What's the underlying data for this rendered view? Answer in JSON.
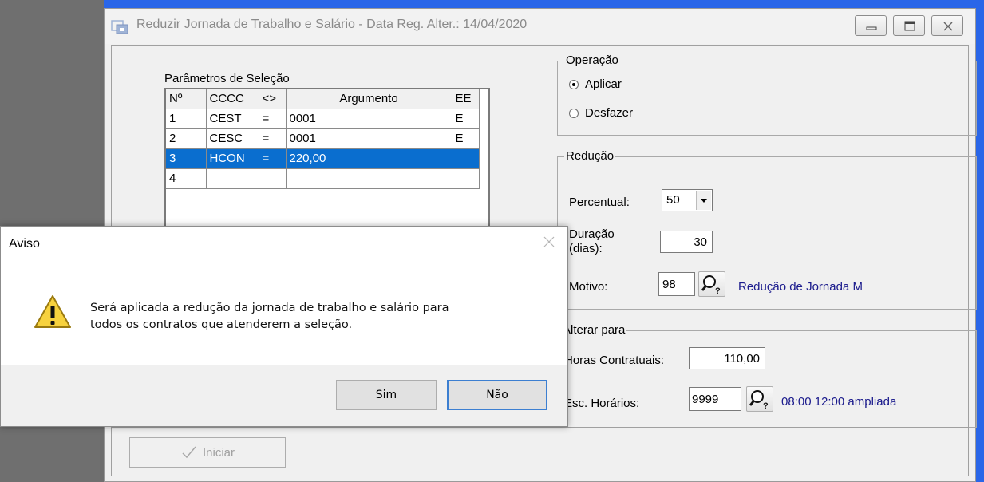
{
  "window": {
    "title": "Reduzir Jornada de Trabalho e Salário - Data Reg. Alter.: 14/04/2020"
  },
  "params": {
    "label": "Parâmetros de Seleção",
    "columns": [
      "Nº",
      "CCCC",
      "<>",
      "Argumento",
      "EE"
    ],
    "rows": [
      [
        "1",
        "CEST",
        "=",
        "0001",
        "E"
      ],
      [
        "2",
        "CESC",
        "=",
        "0001",
        "E"
      ],
      [
        "3",
        "HCON",
        "=",
        "220,00",
        ""
      ],
      [
        "4",
        "",
        "",
        "",
        ""
      ]
    ],
    "selected_row": 2
  },
  "operacao": {
    "title": "Operação",
    "aplicar": "Aplicar",
    "desfazer": "Desfazer",
    "selected": "Aplicar"
  },
  "reducao": {
    "title": "Redução",
    "percentual_label": "Percentual:",
    "percentual_value": "50",
    "duracao_label_1": "Duração",
    "duracao_label_2": "(dias):",
    "duracao_value": "30",
    "motivo_label": "Motivo:",
    "motivo_value": "98",
    "motivo_desc": "Redução de Jornada M"
  },
  "alterar": {
    "title": "Alterar para",
    "horas_label": "Horas Contratuais:",
    "horas_value": "110,00",
    "esc_label": "Esc. Horários:",
    "esc_value": "9999",
    "esc_desc": "08:00 12:00 ampliada"
  },
  "bottom": {
    "iniciar_label": "Iniciar"
  },
  "dialog": {
    "title": "Aviso",
    "message_line1": "Será aplicada a redução da jornada de trabalho e salário para",
    "message_line2": "todos os contratos que atenderem a seleção.",
    "yes_label": "Sim",
    "no_label": "Não",
    "icon": "warning-icon"
  }
}
